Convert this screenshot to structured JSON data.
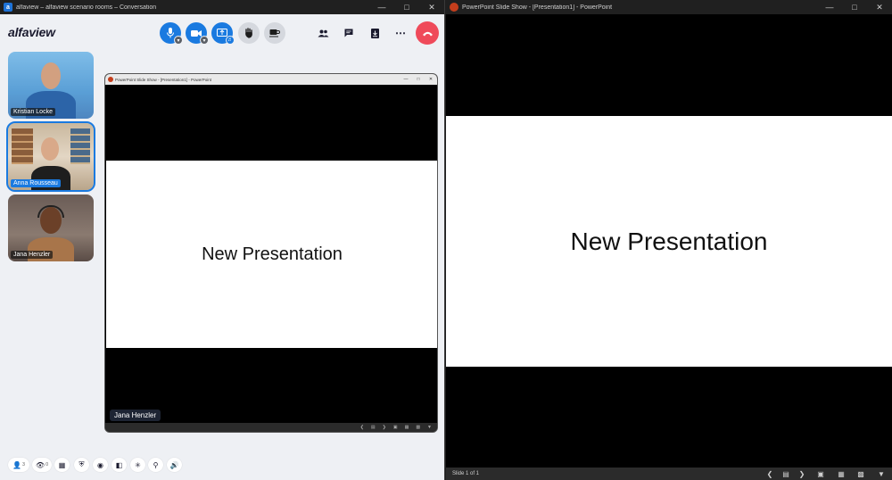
{
  "alfaview": {
    "window_title": "alfaview – alfaview scenario rooms – Conversation",
    "app_icon_letter": "a",
    "logo": "alfaview",
    "participants": [
      {
        "name": "Kristian Locke"
      },
      {
        "name": "Anna Rousseau"
      },
      {
        "name": "Jana Henzler"
      }
    ],
    "controls": {
      "mic_icon": "microphone-icon",
      "camera_icon": "camera-icon",
      "share_icon": "screen-share-icon",
      "hand_icon": "raise-hand-icon",
      "coffee_icon": "coffee-break-icon",
      "leave_icon": "hang-up-icon"
    },
    "shared_screen": {
      "window_title": "PowerPoint Slide Show - [Presentation1] - PowerPoint",
      "slide_text": "New Presentation",
      "presenter": "Jana Henzler"
    },
    "bottom_bar": {
      "participants_count": "3",
      "viewers_count": "0"
    },
    "accent_color": "#1a7ae0",
    "leave_color": "#ef4a5a"
  },
  "powerpoint": {
    "window_title": "PowerPoint Slide Show - [Presentation1] - PowerPoint",
    "slide_text": "New Presentation",
    "status_text": "Slide 1 of 1"
  }
}
